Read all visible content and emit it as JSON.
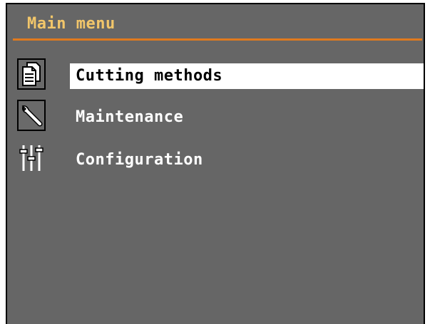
{
  "header": {
    "title": "Main menu",
    "title_color": "#f2c66a",
    "rule_color": "#e07a1e"
  },
  "menu": {
    "items": [
      {
        "label": "Cutting methods",
        "icon": "document-icon",
        "selected": true
      },
      {
        "label": "Maintenance",
        "icon": "wrench-icon",
        "selected": false
      },
      {
        "label": "Configuration",
        "icon": "sliders-icon",
        "selected": false
      }
    ]
  },
  "colors": {
    "background": "#666666",
    "selection_bg": "#ffffff",
    "selection_text": "#000000",
    "text": "#ffffff"
  }
}
